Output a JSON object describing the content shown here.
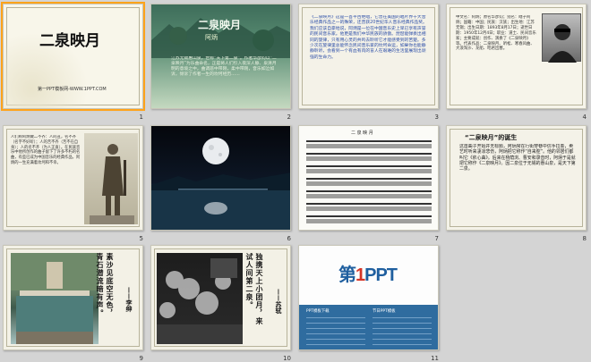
{
  "slides": [
    {
      "num": "1",
      "title": "二泉映月",
      "footer": "第一PPT模板网-WWW.1PPT.COM"
    },
    {
      "num": "2",
      "title": "二泉映月",
      "author": "阿炳",
      "body": "江苏无锡惠山泉，世称“天下第二泉”。作者华彦钧以“二泉映月”为乐曲命名，正是将人们引入夜深人静、泉清月明的意境之中，曲调悲中带刚，柔中带刚，音乐如泣如诉，倾诉了作者一生的坎坷经历……"
    },
    {
      "num": "3",
      "body": "《二泉映月》这是一首平古绝唱，它曾在美国的唱片界十大音乐经典作品之一的殊荣，还曾获20世纪华人音乐经典作品奖。我们应该自豪地说，阿炳是一位在中国音乐史上早已享有声誉的民间音乐家。他更是我们中华民族的骄傲。琵琶能弹奏出相同的旋律，只有用心灵的共鸣去聆听它才能感受到的苦楚。多少次在旋律里总能怀念民间音乐家的坎坷命运，如果你也能静静聆听，会看到一个有血有肉的盲人在艰难的生活里展现出顽强的生命力。"
    },
    {
      "num": "4",
      "body": "中文名：阿炳；原名华彦钧；别名：瞎子阿炳；国籍：中国；民族：汉族；出生地：江苏无锡；出生日期：1893年8月17日；逝世日期：1950年12月4日；职业：道士、民间音乐家；主要成就：创作、演奏了《二泉映月》等。代表作品：二泉映月、听松、寒春风曲、大浪淘沙、龙船、昭君出塞。"
    },
    {
      "num": "5",
      "body": "人们称阿炳做二不齐：人的丑，名不齐（名字不好听）；人的苦不齐（苦不在自身）；人的名不齐（为人正直）。在民族音乐中他所创作的曲子留下了许多不朽的名曲，有些已成为中国音乐的经典作品，阿炳的一生充满着坎坷和不幸。"
    },
    {
      "num": "6"
    },
    {
      "num": "7",
      "title": "二 泉 映 月"
    },
    {
      "num": "8",
      "title": "“二泉映月”的诞生",
      "body": "这首曲子开始并无标题，阿炳常在行街穿巷中信手拉奏，卖艺时听来凄凉悲伤，阿炳把它称作“自来腔”。他的邻居们都叫它《依心曲》。后来在杨荫浏、曹安和录音时，阿炳于是就把它称作《二泉映月》。因二泉位于无锡的惠山泉，是天下第二泉。"
    },
    {
      "num": "9",
      "poem": "素沙见底空无色，青石潜流暗有声。",
      "poet": "——李绅"
    },
    {
      "num": "10",
      "poem": "独携天上小团月，来试人间第二泉。",
      "poet": "——苏轼"
    },
    {
      "num": "11",
      "brand_a": "第",
      "brand_b": "1",
      "brand_c": "PPT",
      "link_left": "PPT模板下载",
      "link_right": "节日PPT模板"
    }
  ]
}
